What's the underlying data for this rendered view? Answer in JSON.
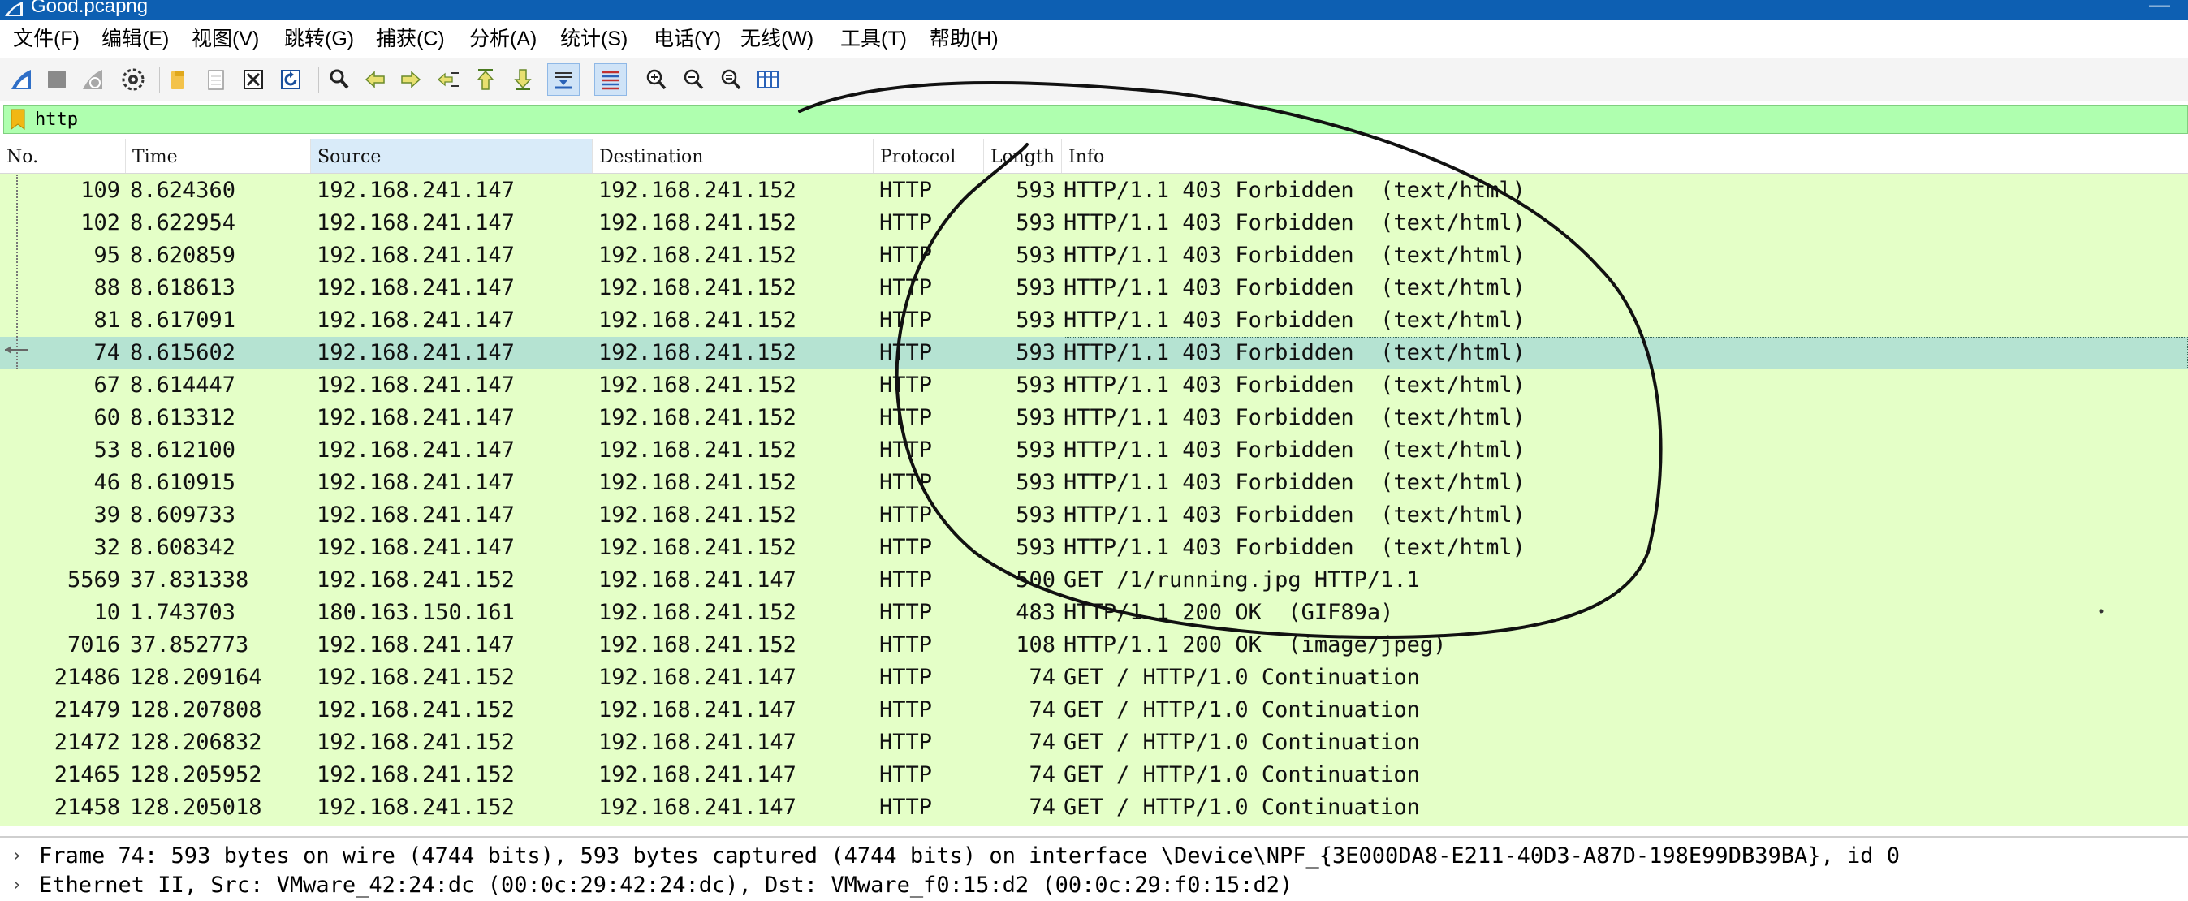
{
  "window": {
    "title": "Good.pcapng",
    "close_glyph": "—"
  },
  "menu": [
    {
      "label": "文件(F)"
    },
    {
      "label": "编辑(E)"
    },
    {
      "label": "视图(V)"
    },
    {
      "label": "跳转(G)"
    },
    {
      "label": "捕获(C)"
    },
    {
      "label": "分析(A)"
    },
    {
      "label": "统计(S)"
    },
    {
      "label": "电话(Y)"
    },
    {
      "label": "无线(W)"
    },
    {
      "label": "工具(T)"
    },
    {
      "label": "帮助(H)"
    }
  ],
  "toolbar_icons": [
    "shark-fin-start-icon",
    "stop-square-icon",
    "restart-fin-icon",
    "capture-options-gear-icon",
    "open-folder-icon",
    "file-icon",
    "close-file-icon",
    "reload-icon",
    "find-packet-icon",
    "go-back-arrow-icon",
    "go-forward-arrow-icon",
    "go-to-packet-icon",
    "first-packet-icon",
    "last-packet-icon",
    "autoscroll-icon",
    "colorize-icon",
    "zoom-in-icon",
    "zoom-out-icon",
    "normal-size-icon",
    "resize-columns-icon"
  ],
  "filter": {
    "value": "http"
  },
  "columns": [
    "No.",
    "Time",
    "Source",
    "Destination",
    "Protocol",
    "Length",
    "Info"
  ],
  "packets": [
    {
      "no": "109",
      "time": "8.624360",
      "src": "192.168.241.147",
      "dst": "192.168.241.152",
      "proto": "HTTP",
      "len": "593",
      "info": "HTTP/1.1 403 Forbidden  (text/html)"
    },
    {
      "no": "102",
      "time": "8.622954",
      "src": "192.168.241.147",
      "dst": "192.168.241.152",
      "proto": "HTTP",
      "len": "593",
      "info": "HTTP/1.1 403 Forbidden  (text/html)"
    },
    {
      "no": "95",
      "time": "8.620859",
      "src": "192.168.241.147",
      "dst": "192.168.241.152",
      "proto": "HTTP",
      "len": "593",
      "info": "HTTP/1.1 403 Forbidden  (text/html)"
    },
    {
      "no": "88",
      "time": "8.618613",
      "src": "192.168.241.147",
      "dst": "192.168.241.152",
      "proto": "HTTP",
      "len": "593",
      "info": "HTTP/1.1 403 Forbidden  (text/html)"
    },
    {
      "no": "81",
      "time": "8.617091",
      "src": "192.168.241.147",
      "dst": "192.168.241.152",
      "proto": "HTTP",
      "len": "593",
      "info": "HTTP/1.1 403 Forbidden  (text/html)"
    },
    {
      "no": "74",
      "time": "8.615602",
      "src": "192.168.241.147",
      "dst": "192.168.241.152",
      "proto": "HTTP",
      "len": "593",
      "info": "HTTP/1.1 403 Forbidden  (text/html)",
      "selected": true
    },
    {
      "no": "67",
      "time": "8.614447",
      "src": "192.168.241.147",
      "dst": "192.168.241.152",
      "proto": "HTTP",
      "len": "593",
      "info": "HTTP/1.1 403 Forbidden  (text/html)"
    },
    {
      "no": "60",
      "time": "8.613312",
      "src": "192.168.241.147",
      "dst": "192.168.241.152",
      "proto": "HTTP",
      "len": "593",
      "info": "HTTP/1.1 403 Forbidden  (text/html)"
    },
    {
      "no": "53",
      "time": "8.612100",
      "src": "192.168.241.147",
      "dst": "192.168.241.152",
      "proto": "HTTP",
      "len": "593",
      "info": "HTTP/1.1 403 Forbidden  (text/html)"
    },
    {
      "no": "46",
      "time": "8.610915",
      "src": "192.168.241.147",
      "dst": "192.168.241.152",
      "proto": "HTTP",
      "len": "593",
      "info": "HTTP/1.1 403 Forbidden  (text/html)"
    },
    {
      "no": "39",
      "time": "8.609733",
      "src": "192.168.241.147",
      "dst": "192.168.241.152",
      "proto": "HTTP",
      "len": "593",
      "info": "HTTP/1.1 403 Forbidden  (text/html)"
    },
    {
      "no": "32",
      "time": "8.608342",
      "src": "192.168.241.147",
      "dst": "192.168.241.152",
      "proto": "HTTP",
      "len": "593",
      "info": "HTTP/1.1 403 Forbidden  (text/html)"
    },
    {
      "no": "5569",
      "time": "37.831338",
      "src": "192.168.241.152",
      "dst": "192.168.241.147",
      "proto": "HTTP",
      "len": "500",
      "info": "GET /1/running.jpg HTTP/1.1"
    },
    {
      "no": "10",
      "time": "1.743703",
      "src": "180.163.150.161",
      "dst": "192.168.241.152",
      "proto": "HTTP",
      "len": "483",
      "info": "HTTP/1.1 200 OK  (GIF89a)"
    },
    {
      "no": "7016",
      "time": "37.852773",
      "src": "192.168.241.147",
      "dst": "192.168.241.152",
      "proto": "HTTP",
      "len": "108",
      "info": "HTTP/1.1 200 OK  (image/jpeg)"
    },
    {
      "no": "21486",
      "time": "128.209164",
      "src": "192.168.241.152",
      "dst": "192.168.241.147",
      "proto": "HTTP",
      "len": "74",
      "info": "GET / HTTP/1.0 Continuation"
    },
    {
      "no": "21479",
      "time": "128.207808",
      "src": "192.168.241.152",
      "dst": "192.168.241.147",
      "proto": "HTTP",
      "len": "74",
      "info": "GET / HTTP/1.0 Continuation"
    },
    {
      "no": "21472",
      "time": "128.206832",
      "src": "192.168.241.152",
      "dst": "192.168.241.147",
      "proto": "HTTP",
      "len": "74",
      "info": "GET / HTTP/1.0 Continuation"
    },
    {
      "no": "21465",
      "time": "128.205952",
      "src": "192.168.241.152",
      "dst": "192.168.241.147",
      "proto": "HTTP",
      "len": "74",
      "info": "GET / HTTP/1.0 Continuation"
    },
    {
      "no": "21458",
      "time": "128.205018",
      "src": "192.168.241.152",
      "dst": "192.168.241.147",
      "proto": "HTTP",
      "len": "74",
      "info": "GET / HTTP/1.0 Continuation"
    }
  ],
  "details": [
    {
      "text": "Frame 74: 593 bytes on wire (4744 bits), 593 bytes captured (4744 bits) on interface \\Device\\NPF_{3E000DA8-E211-40D3-A87D-198E99DB39BA}, id 0"
    },
    {
      "text": "Ethernet II, Src: VMware_42:24:dc (00:0c:29:42:24:dc), Dst: VMware_f0:15:d2 (00:0c:29:f0:15:d2)"
    }
  ],
  "colors": {
    "titlebar": "#0d5fb2",
    "filter_bg": "#afffaf",
    "row_bg": "#e4ffc7",
    "row_selected": "#b5e3d2",
    "annotation_ink": "#111111"
  }
}
